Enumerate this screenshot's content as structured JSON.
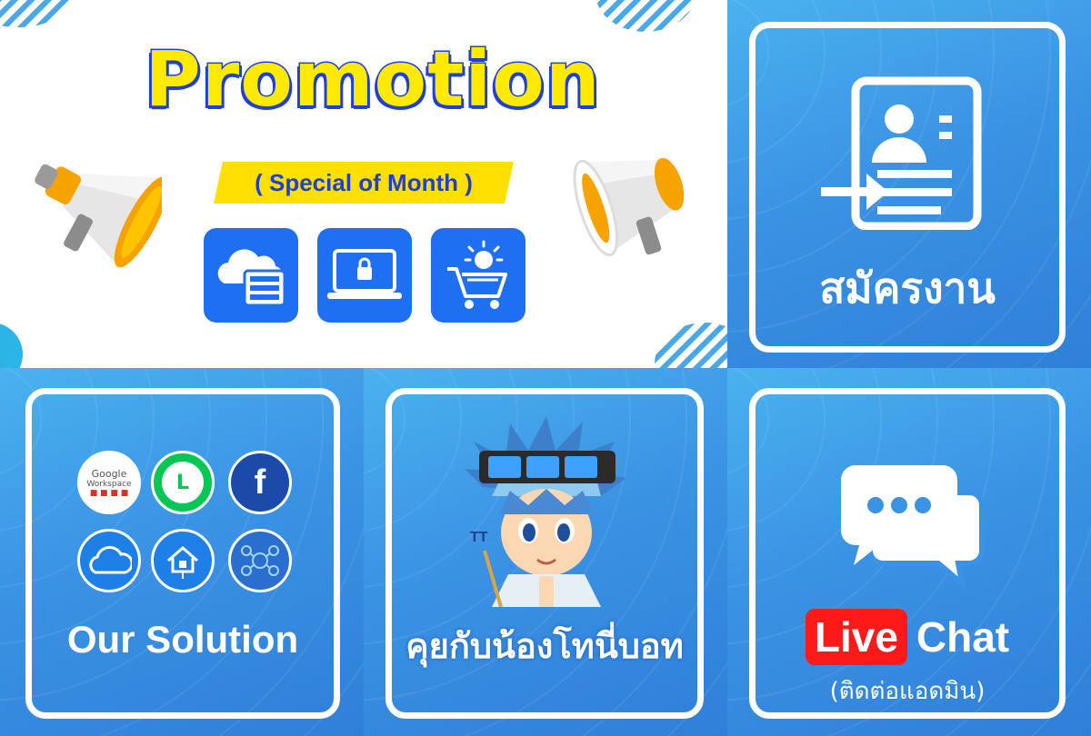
{
  "promotion": {
    "title": "Promotion",
    "subtitle": "( Special of Month )",
    "icons": [
      "cloud-server-icon",
      "laptop-lock-icon",
      "shopping-cart-bulb-icon"
    ],
    "colors": {
      "title_fill": "#ffea00",
      "title_stroke": "#1f3fd6",
      "icon_bg": "#1e6ff2",
      "banner": "#ffe000"
    }
  },
  "apply_job": {
    "label": "สมัครงาน",
    "icon": "job-application-icon"
  },
  "solution": {
    "label": "Our Solution",
    "logos": [
      {
        "name": "google-workspace-logo",
        "line1": "Google",
        "line2": "Workspace"
      },
      {
        "name": "line-logo",
        "text": "L"
      },
      {
        "name": "facebook-logo",
        "text": "f"
      },
      {
        "name": "cloud-logo"
      },
      {
        "name": "smart-home-logo"
      },
      {
        "name": "network-logo"
      }
    ]
  },
  "chatbot": {
    "label": "คุยกับน้องโทนี่บอท",
    "mascot": "tony-bot-mascot"
  },
  "live_chat": {
    "badge": "Live",
    "label": "Chat",
    "sub": "(ติดต่อแอดมิน)",
    "icon": "chat-bubbles-icon",
    "badge_color": "#ff1a1a"
  }
}
